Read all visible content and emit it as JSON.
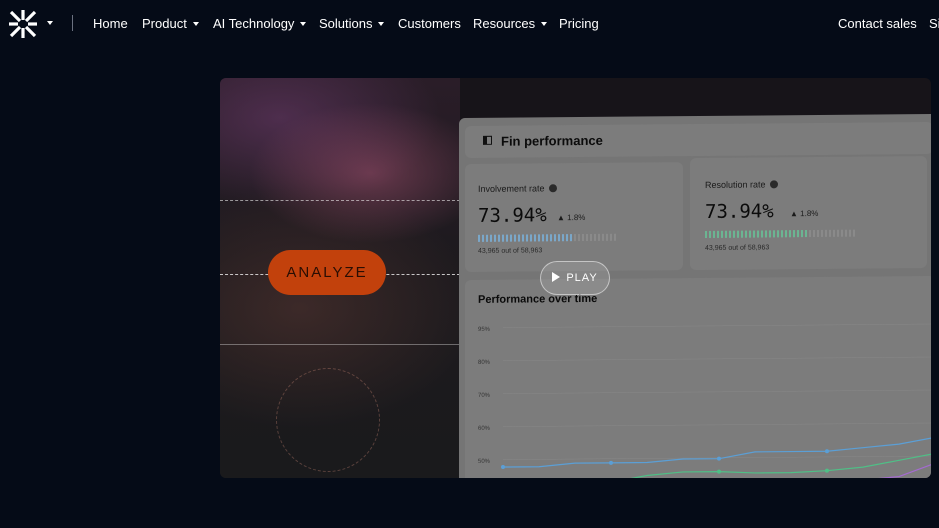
{
  "nav": {
    "items": [
      {
        "label": "Home",
        "dropdown": false
      },
      {
        "label": "Product",
        "dropdown": true
      },
      {
        "label": "AI Technology",
        "dropdown": true
      },
      {
        "label": "Solutions",
        "dropdown": true
      },
      {
        "label": "Customers",
        "dropdown": false
      },
      {
        "label": "Resources",
        "dropdown": true
      },
      {
        "label": "Pricing",
        "dropdown": false
      }
    ],
    "contact_sales": "Contact sales",
    "sign_in": "Si"
  },
  "video": {
    "analyze_label": "ANALYZE",
    "play_label": "PLAY",
    "accent_color": "#c2410c",
    "dashboard": {
      "title": "Fin performance",
      "cards": [
        {
          "label": "Involvement rate",
          "value": "73.94%",
          "delta": "1.8%",
          "sub": "43,965 out of 58,963",
          "bar_color": "#7aa7c9",
          "fill": 0.68
        },
        {
          "label": "Resolution rate",
          "value": "73.94%",
          "delta": "1.8%",
          "sub": "43,965 out of 58,963",
          "bar_color": "#6bb592",
          "fill": 0.68
        }
      ],
      "chart": {
        "title": "Performance over time",
        "ticks": [
          "95%",
          "80%",
          "70%",
          "60%",
          "50%"
        ]
      }
    }
  },
  "chart_data": {
    "type": "line",
    "title": "Performance over time",
    "ylim": [
      45,
      95
    ],
    "y_ticks": [
      "95%",
      "80%",
      "70%",
      "60%",
      "50%"
    ],
    "x": [
      0,
      1,
      2,
      3,
      4,
      5,
      6,
      7,
      8,
      9,
      10,
      11,
      12
    ],
    "series": [
      {
        "color": "#5b9fd6",
        "values": [
          52,
          52,
          53,
          53,
          53,
          54,
          54,
          56,
          56,
          56,
          57,
          58,
          60
        ]
      },
      {
        "color": "#4fbf86",
        "values": [
          45,
          45.5,
          45,
          47,
          49,
          50,
          50,
          49.5,
          49.5,
          50,
          51,
          53,
          55
        ]
      },
      {
        "color": "#a46ad1",
        "values": [
          40,
          40.5,
          42,
          42.5,
          43,
          42,
          43,
          45,
          46,
          46,
          47,
          48,
          52
        ]
      }
    ]
  }
}
